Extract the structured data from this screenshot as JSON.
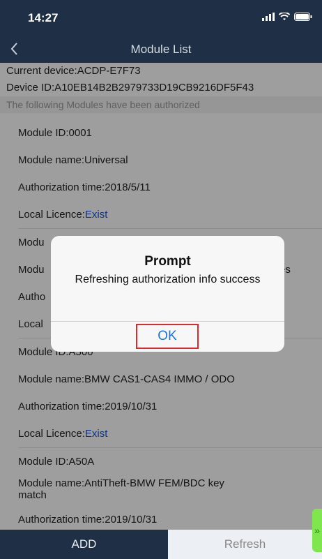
{
  "status_bar": {
    "time": "14:27"
  },
  "nav": {
    "title": "Module List"
  },
  "info": {
    "current_device": "Current device:ACDP-E7F73",
    "device_id": "Device ID:A10EB14B2B2979733D19CB9216DF5F43",
    "notice": "The following Modules have been authorized"
  },
  "modules": [
    {
      "id": "Module ID:0001",
      "name": "Module name:Universal",
      "time": "Authorization time:2018/5/11",
      "licence_label": "Local Licence:",
      "licence_value": "Exist"
    },
    {
      "id_partial": "Modu",
      "name_partial": "Modu",
      "name_tail": "es",
      "time_partial": "Autho",
      "licence_partial": "Local"
    },
    {
      "id": "Module ID:A500",
      "name": "Module name:BMW CAS1-CAS4 IMMO / ODO",
      "time": "Authorization time:2019/10/31",
      "licence_label": "Local Licence:",
      "licence_value": "Exist"
    },
    {
      "id": "Module ID:A50A",
      "name": "Module name:AntiTheft-BMW FEM/BDC key match",
      "time": "Authorization time:2019/10/31"
    }
  ],
  "dialog": {
    "title": "Prompt",
    "message": "Refreshing  authorization info success",
    "ok_label": "OK"
  },
  "bottom": {
    "add_label": "ADD",
    "refresh_label": "Refresh"
  },
  "colors": {
    "nav_bg": "#1f2f45",
    "exist_text": "#1b4fd0",
    "ok_text": "#1a73e8",
    "highlight_border": "#e0282a"
  }
}
